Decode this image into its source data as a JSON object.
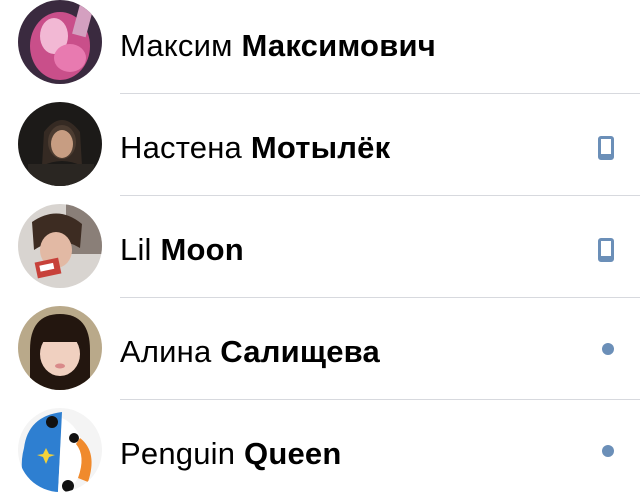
{
  "contacts": [
    {
      "first": "Максим",
      "last": "Максимович",
      "status": "none",
      "avatar": "avatar-pink-photo"
    },
    {
      "first": "Настена",
      "last": "Мотылёк",
      "status": "mobile",
      "avatar": "avatar-dark-photo"
    },
    {
      "first": "Lil",
      "last": "Moon",
      "status": "mobile",
      "avatar": "avatar-girl-photo"
    },
    {
      "first": "Алина",
      "last": "Салищева",
      "status": "online",
      "avatar": "avatar-bangs-photo"
    },
    {
      "first": "Penguin",
      "last": "Queen",
      "status": "online",
      "avatar": "avatar-penguin-drawing"
    }
  ],
  "colors": {
    "status_icon": "#6b8fb8",
    "divider": "#d7d9de",
    "text": "#000000"
  },
  "icons": {
    "mobile": "mobile-phone-icon",
    "online": "online-dot-icon"
  }
}
